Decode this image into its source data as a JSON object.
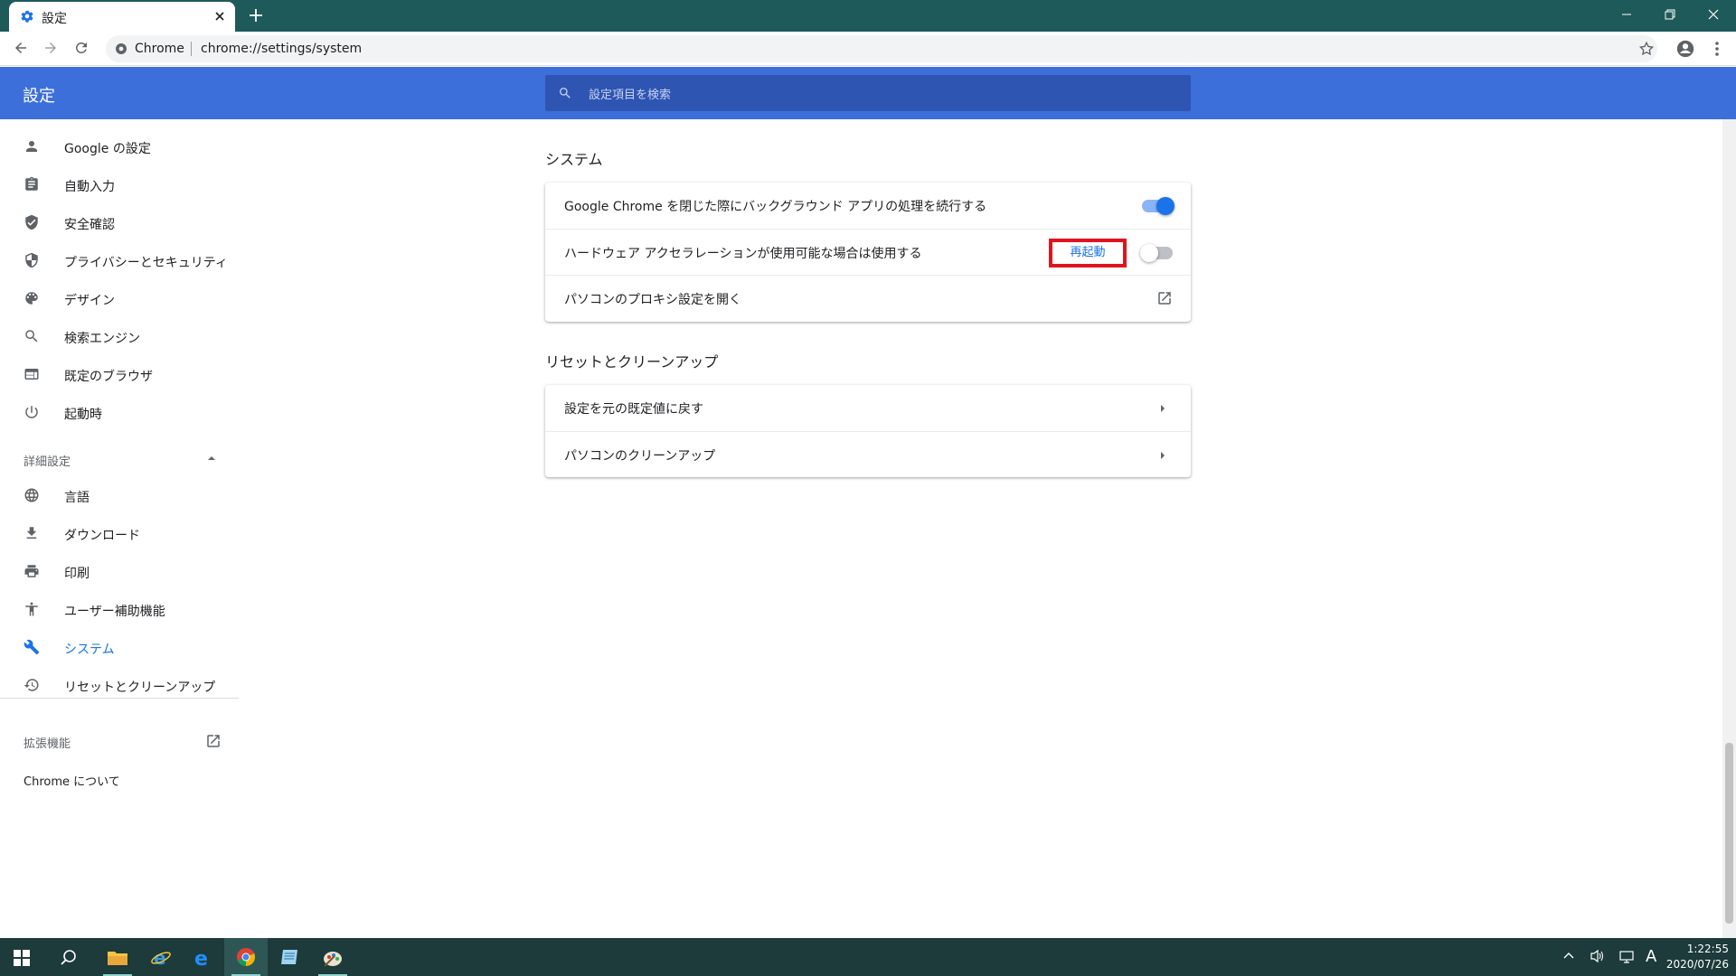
{
  "browser": {
    "tab_title": "設定",
    "site_name": "Chrome",
    "url": "chrome://settings/system"
  },
  "settings": {
    "header_title": "設定",
    "search_placeholder": "設定項目を検索",
    "nav": {
      "items": [
        {
          "label": "Google の設定",
          "icon": "person-icon"
        },
        {
          "label": "自動入力",
          "icon": "clipboard-icon"
        },
        {
          "label": "安全確認",
          "icon": "shield-check-icon"
        },
        {
          "label": "プライバシーとセキュリティ",
          "icon": "shield-icon"
        },
        {
          "label": "デザイン",
          "icon": "palette-icon"
        },
        {
          "label": "検索エンジン",
          "icon": "search-icon"
        },
        {
          "label": "既定のブラウザ",
          "icon": "browser-window-icon"
        },
        {
          "label": "起動時",
          "icon": "power-icon"
        }
      ],
      "advanced_label": "詳細設定",
      "advanced_items": [
        {
          "label": "言語",
          "icon": "globe-icon"
        },
        {
          "label": "ダウンロード",
          "icon": "download-icon"
        },
        {
          "label": "印刷",
          "icon": "printer-icon"
        },
        {
          "label": "ユーザー補助機能",
          "icon": "accessibility-icon"
        },
        {
          "label": "システム",
          "icon": "wrench-icon",
          "active": true
        },
        {
          "label": "リセットとクリーンアップ",
          "icon": "history-icon"
        }
      ],
      "extensions_label": "拡張機能",
      "about_label": "Chrome について"
    },
    "system": {
      "title": "システム",
      "rows": [
        {
          "label": "Google Chrome を閉じた際にバックグラウンド アプリの処理を続行する",
          "toggle": true
        },
        {
          "label": "ハードウェア アクセラレーションが使用可能な場合は使用する",
          "toggle": false,
          "button_label": "再起動"
        },
        {
          "label": "パソコンのプロキシ設定を開く"
        }
      ]
    },
    "reset": {
      "title": "リセットとクリーンアップ",
      "rows": [
        {
          "label": "設定を元の既定値に戻す"
        },
        {
          "label": "パソコンのクリーンアップ"
        }
      ]
    }
  },
  "taskbar": {
    "time": "1:22:55",
    "date": "2020/07/26",
    "ime": "A"
  },
  "colors": {
    "header_blue": "#3c6fda",
    "accent_blue": "#1a73e8",
    "highlight_red": "#e0141e",
    "titlebar_teal": "#1e5a59"
  }
}
